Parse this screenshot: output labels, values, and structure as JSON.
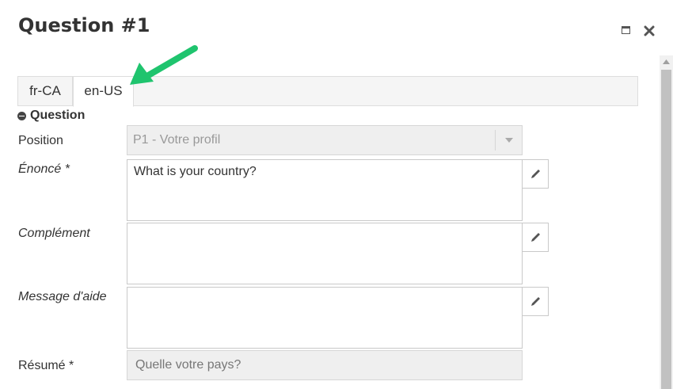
{
  "dialog": {
    "title": "Question #1"
  },
  "tabs": [
    {
      "label": "fr-CA",
      "active": false
    },
    {
      "label": "en-US",
      "active": true
    }
  ],
  "section": {
    "title": "Question"
  },
  "fields": {
    "position": {
      "label": "Position",
      "value": "P1 - Votre profil"
    },
    "enonce": {
      "label": "Énoncé *",
      "value": "What is your country?"
    },
    "complement": {
      "label": "Complément",
      "value": ""
    },
    "message_aide": {
      "label": "Message d'aide",
      "value": ""
    },
    "resume": {
      "label": "Résumé *",
      "value": "Quelle votre pays?"
    }
  },
  "icons": {
    "maximize": "maximize-icon",
    "close": "close-icon",
    "collapse": "minus-circle-icon",
    "edit": "pencil-icon",
    "annotation": "green-arrow-icon"
  },
  "colors": {
    "arrow": "#1fc46e",
    "tab_bar": "#f5f5f5",
    "disabled_field": "#efefef"
  }
}
